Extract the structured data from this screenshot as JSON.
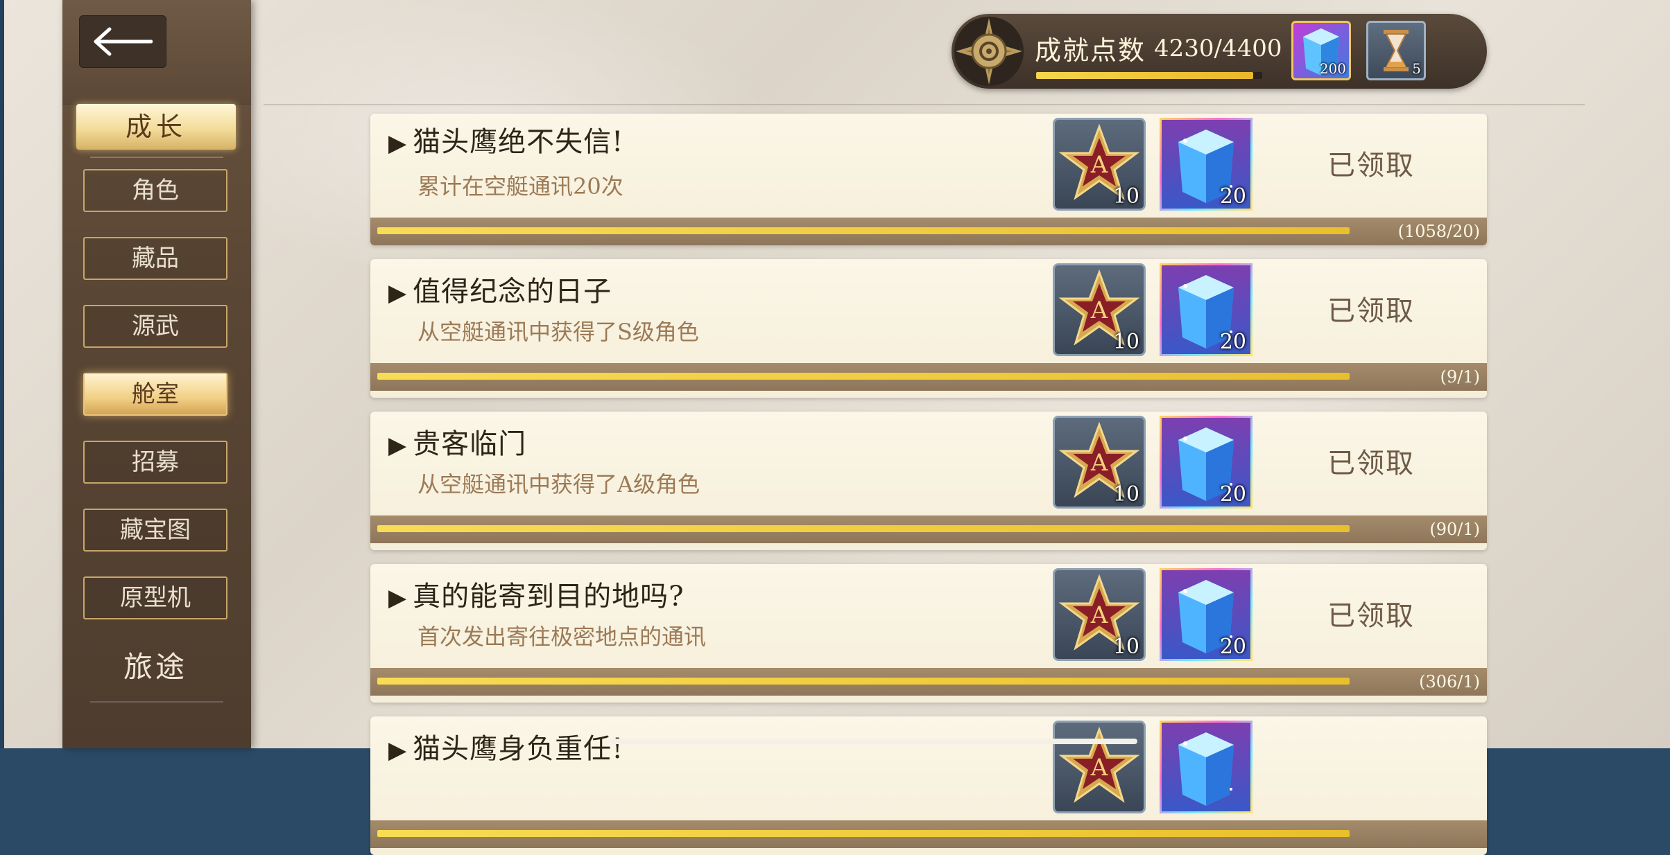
{
  "header": {
    "points_label": "成就点数",
    "points_value": "4230/4400",
    "points_fraction": 0.9614,
    "currencies": [
      {
        "name": "crystal",
        "count": "200"
      },
      {
        "name": "hourglass",
        "count": "5"
      }
    ]
  },
  "sidebar": {
    "category": "成长",
    "items": [
      {
        "label": "角色"
      },
      {
        "label": "藏品"
      },
      {
        "label": "源武"
      },
      {
        "label": "舱室"
      },
      {
        "label": "招募"
      },
      {
        "label": "藏宝图"
      },
      {
        "label": "原型机"
      }
    ],
    "active_index": 3,
    "journey": "旅途"
  },
  "achievements": [
    {
      "title": "猫头鹰绝不失信!",
      "desc": "累计在空艇通讯20次",
      "reward_a": "10",
      "reward_crystal": "20",
      "status": "已领取",
      "progress": "(1058/20)"
    },
    {
      "title": "值得纪念的日子",
      "desc": "从空艇通讯中获得了S级角色",
      "reward_a": "10",
      "reward_crystal": "20",
      "status": "已领取",
      "progress": "(9/1)"
    },
    {
      "title": "贵客临门",
      "desc": "从空艇通讯中获得了A级角色",
      "reward_a": "10",
      "reward_crystal": "20",
      "status": "已领取",
      "progress": "(90/1)"
    },
    {
      "title": "真的能寄到目的地吗?",
      "desc": "首次发出寄往极密地点的通讯",
      "reward_a": "10",
      "reward_crystal": "20",
      "status": "已领取",
      "progress": "(306/1)"
    },
    {
      "title": "猫头鹰身负重任!",
      "desc": "",
      "reward_a": "",
      "reward_crystal": "",
      "status": "",
      "progress": ""
    }
  ],
  "colors": {
    "accent_gold": "#f3d24e",
    "panel_brown": "#5a4634",
    "card_bg": "#f8f2e0"
  }
}
